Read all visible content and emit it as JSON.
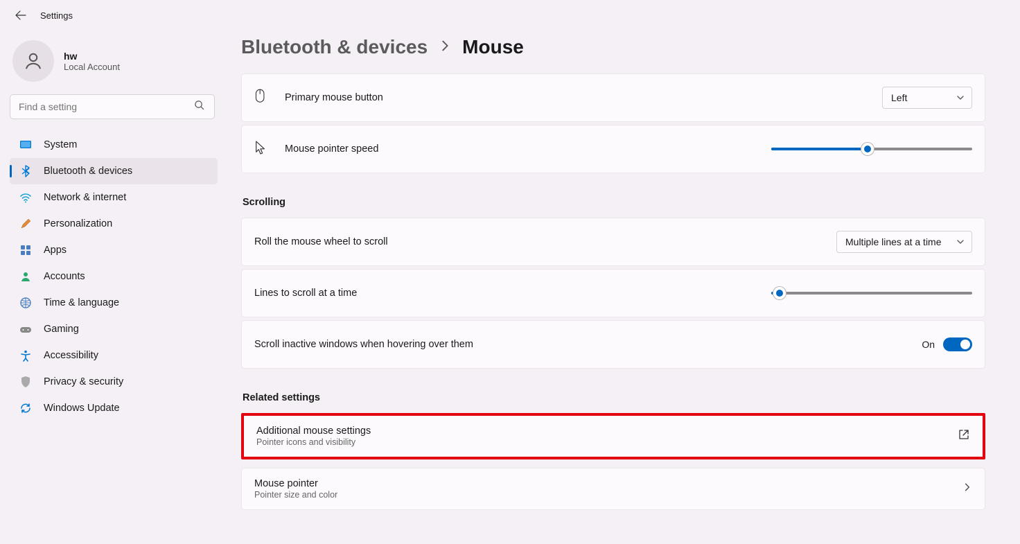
{
  "window": {
    "title": "Settings"
  },
  "user": {
    "name": "hw",
    "type": "Local Account"
  },
  "search": {
    "placeholder": "Find a setting"
  },
  "nav": {
    "items": [
      {
        "label": "System"
      },
      {
        "label": "Bluetooth & devices"
      },
      {
        "label": "Network & internet"
      },
      {
        "label": "Personalization"
      },
      {
        "label": "Apps"
      },
      {
        "label": "Accounts"
      },
      {
        "label": "Time & language"
      },
      {
        "label": "Gaming"
      },
      {
        "label": "Accessibility"
      },
      {
        "label": "Privacy & security"
      },
      {
        "label": "Windows Update"
      }
    ],
    "selected_index": 1
  },
  "breadcrumb": {
    "parent": "Bluetooth & devices",
    "current": "Mouse"
  },
  "mouse": {
    "primary_button": {
      "label": "Primary mouse button",
      "value": "Left"
    },
    "pointer_speed": {
      "label": "Mouse pointer speed",
      "value_percent": 48
    }
  },
  "scrolling": {
    "header": "Scrolling",
    "roll": {
      "label": "Roll the mouse wheel to scroll",
      "value": "Multiple lines at a time"
    },
    "lines": {
      "label": "Lines to scroll at a time",
      "value_percent": 4
    },
    "inactive": {
      "label": "Scroll inactive windows when hovering over them",
      "state_label": "On",
      "on": true
    }
  },
  "related": {
    "header": "Related settings",
    "items": [
      {
        "title": "Additional mouse settings",
        "sub": "Pointer icons and visibility"
      },
      {
        "title": "Mouse pointer",
        "sub": "Pointer size and color"
      }
    ]
  }
}
